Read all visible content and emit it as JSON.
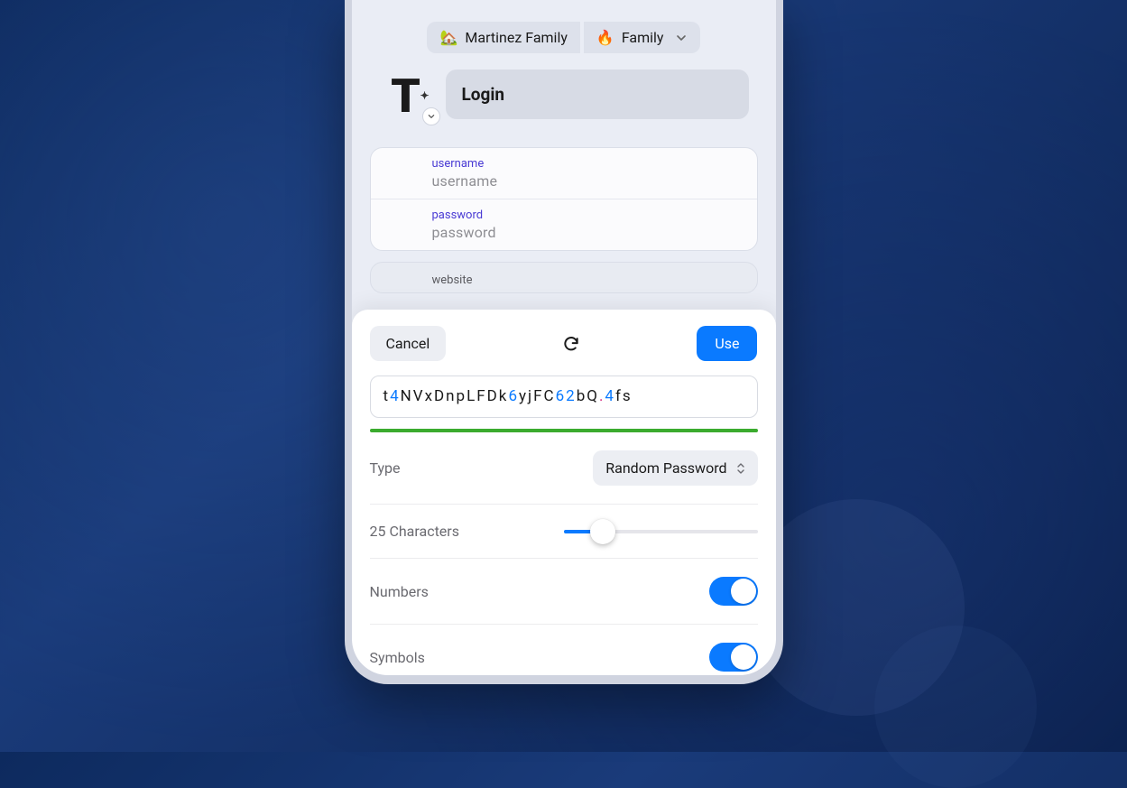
{
  "vaults": {
    "primary": {
      "emoji": "🏡",
      "name": "Martinez Family"
    },
    "secondary": {
      "emoji": "🔥",
      "name": "Family"
    }
  },
  "item": {
    "title": "Login",
    "logo_letter": "T"
  },
  "fields": {
    "username": {
      "label": "username",
      "value": "username"
    },
    "password": {
      "label": "password",
      "value": "password"
    },
    "website": {
      "label": "website"
    }
  },
  "generator": {
    "cancel": "Cancel",
    "use": "Use",
    "password_segments": [
      {
        "t": "l",
        "v": "t"
      },
      {
        "t": "d",
        "v": "4"
      },
      {
        "t": "l",
        "v": "NVxDnpLFDk"
      },
      {
        "t": "d",
        "v": "6"
      },
      {
        "t": "l",
        "v": "yjFC"
      },
      {
        "t": "d",
        "v": "62"
      },
      {
        "t": "l",
        "v": "bQ"
      },
      {
        "t": "s",
        "v": "."
      },
      {
        "t": "d",
        "v": "4"
      },
      {
        "t": "l",
        "v": "fs"
      }
    ],
    "type_label": "Type",
    "type_value": "Random Password",
    "length_label": "25 Characters",
    "length_value": 25,
    "numbers_label": "Numbers",
    "numbers_on": true,
    "symbols_label": "Symbols",
    "symbols_on": true
  }
}
